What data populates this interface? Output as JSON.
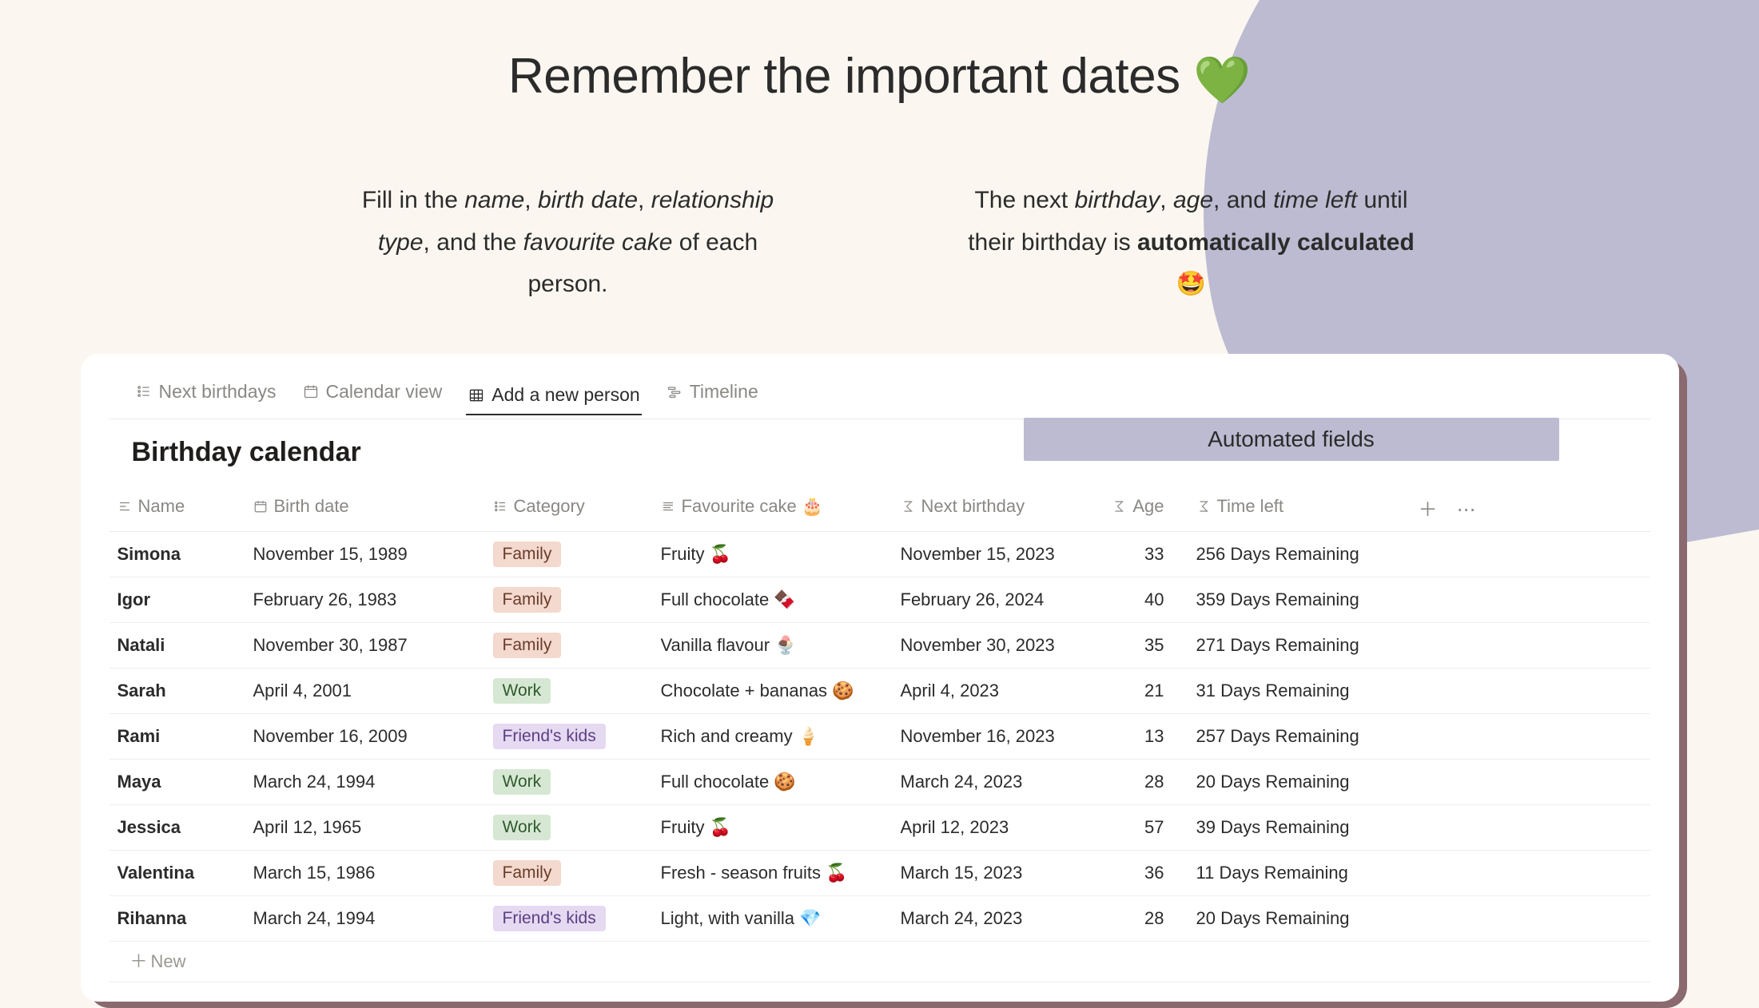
{
  "hero": {
    "title": "Remember the important dates",
    "title_emoji": "💚",
    "sub_left_html": "Fill in the <em>name</em>, <em>birth date</em>, <em>relationship type</em>, and the <em>favourite cake</em> of each person.",
    "sub_right_html": "The next <em>birthday</em>, <em>age</em>, and <em>time left</em> until their birthday is <strong>automatically calculated</strong> 🤩"
  },
  "tabs": [
    {
      "id": "next-birthdays",
      "label": "Next birthdays",
      "icon": "list",
      "active": false
    },
    {
      "id": "calendar-view",
      "label": "Calendar view",
      "icon": "calendar",
      "active": false
    },
    {
      "id": "add-person",
      "label": "Add a new person",
      "icon": "table",
      "active": true
    },
    {
      "id": "timeline",
      "label": "Timeline",
      "icon": "timeline",
      "active": false
    }
  ],
  "database": {
    "title": "Birthday calendar",
    "automated_label": "Automated fields",
    "new_row_label": "New",
    "columns": {
      "name": "Name",
      "birth_date": "Birth date",
      "category": "Category",
      "favourite_cake": "Favourite cake 🎂",
      "next_birthday": "Next birthday",
      "age": "Age",
      "time_left": "Time left"
    },
    "rows": [
      {
        "name": "Simona",
        "birth_date": "November 15, 1989",
        "category": "Family",
        "category_class": "family",
        "cake": "Fruity 🍒",
        "next_birthday": "November 15, 2023",
        "age": "33",
        "time_left": "256 Days Remaining"
      },
      {
        "name": "Igor",
        "birth_date": "February 26, 1983",
        "category": "Family",
        "category_class": "family",
        "cake": "Full chocolate 🍫",
        "next_birthday": "February 26, 2024",
        "age": "40",
        "time_left": "359 Days Remaining"
      },
      {
        "name": "Natali",
        "birth_date": "November 30, 1987",
        "category": "Family",
        "category_class": "family",
        "cake": "Vanilla flavour 🍨",
        "next_birthday": "November 30, 2023",
        "age": "35",
        "time_left": "271 Days Remaining"
      },
      {
        "name": "Sarah",
        "birth_date": "April 4, 2001",
        "category": "Work",
        "category_class": "work",
        "cake": "Chocolate + bananas 🍪",
        "next_birthday": "April 4, 2023",
        "age": "21",
        "time_left": "31 Days Remaining"
      },
      {
        "name": "Rami",
        "birth_date": "November 16, 2009",
        "category": "Friend's kids",
        "category_class": "friends-kids",
        "cake": "Rich and creamy 🍦",
        "next_birthday": "November 16, 2023",
        "age": "13",
        "time_left": "257 Days Remaining"
      },
      {
        "name": "Maya",
        "birth_date": "March 24, 1994",
        "category": "Work",
        "category_class": "work",
        "cake": "Full chocolate 🍪",
        "next_birthday": "March 24, 2023",
        "age": "28",
        "time_left": "20 Days Remaining"
      },
      {
        "name": "Jessica",
        "birth_date": "April 12, 1965",
        "category": "Work",
        "category_class": "work",
        "cake": "Fruity 🍒",
        "next_birthday": "April 12, 2023",
        "age": "57",
        "time_left": "39 Days Remaining"
      },
      {
        "name": "Valentina",
        "birth_date": "March 15, 1986",
        "category": "Family",
        "category_class": "family",
        "cake": "Fresh - season fruits 🍒",
        "next_birthday": "March 15, 2023",
        "age": "36",
        "time_left": "11 Days Remaining"
      },
      {
        "name": "Rihanna",
        "birth_date": "March 24, 1994",
        "category": "Friend's kids",
        "category_class": "friends-kids",
        "cake": "Light, with vanilla 💎",
        "next_birthday": "March 24, 2023",
        "age": "28",
        "time_left": "20 Days Remaining"
      }
    ]
  }
}
